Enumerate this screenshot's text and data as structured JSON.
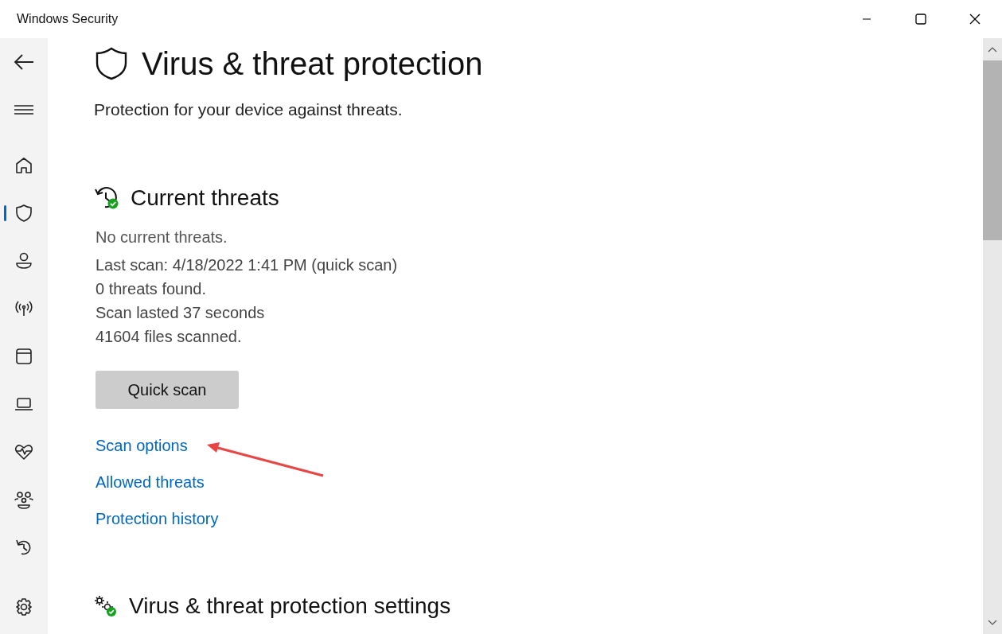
{
  "window": {
    "title": "Windows Security"
  },
  "nav": [
    {
      "selected": false
    },
    {
      "selected": true
    },
    {
      "selected": false
    },
    {
      "selected": false
    },
    {
      "selected": false
    },
    {
      "selected": false
    },
    {
      "selected": false
    },
    {
      "selected": false
    },
    {
      "selected": false
    },
    {
      "selected": false
    }
  ],
  "page": {
    "title": "Virus & threat protection",
    "subtitle": "Protection for your device against threats."
  },
  "current_threats": {
    "heading": "Current threats",
    "status": "No current threats.",
    "details": [
      "Last scan: 4/18/2022 1:41 PM (quick scan)",
      "0 threats found.",
      "Scan lasted 37 seconds",
      "41604 files scanned."
    ],
    "button": "Quick scan",
    "links": [
      "Scan options",
      "Allowed threats",
      "Protection history"
    ]
  },
  "settings": {
    "heading": "Virus & threat protection settings"
  }
}
